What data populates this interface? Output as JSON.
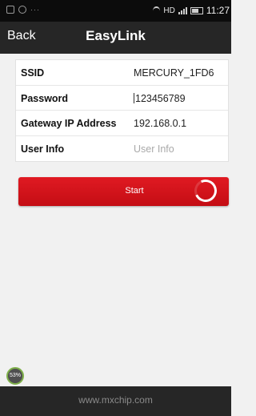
{
  "status_bar": {
    "network_label": "HD",
    "time": "11:27"
  },
  "nav": {
    "back_label": "Back",
    "title": "EasyLink"
  },
  "form": {
    "rows": [
      {
        "label": "SSID",
        "value": "MERCURY_1FD6"
      },
      {
        "label": "Password",
        "value": "123456789"
      },
      {
        "label": "Gateway IP Address",
        "value": "192.168.0.1"
      },
      {
        "label": "User Info",
        "value": "",
        "placeholder": "User Info"
      }
    ]
  },
  "start_button": {
    "label": "Start"
  },
  "progress_badge": {
    "text": "53%"
  },
  "footer": {
    "text": "www.mxchip.com"
  },
  "colors": {
    "accent_red": "#d9151c",
    "nav_background": "#262626",
    "page_background": "#f1f1f1"
  }
}
